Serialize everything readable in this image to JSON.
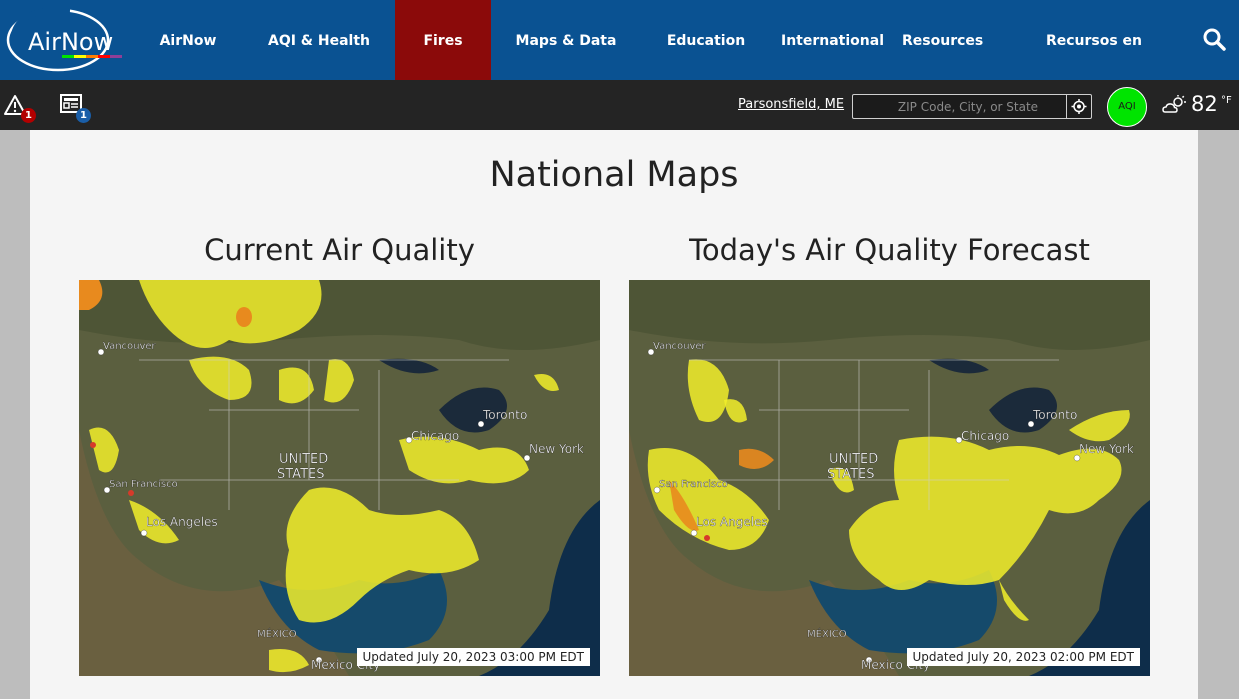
{
  "header": {
    "logo_text": "AirNow",
    "nav": [
      {
        "label": "AirNow"
      },
      {
        "label": "AQI & Health"
      },
      {
        "label": "Fires"
      },
      {
        "label": "Maps & Data"
      },
      {
        "label": "Education"
      },
      {
        "label": "International"
      },
      {
        "label": "Resources"
      },
      {
        "label": "Recursos en español"
      }
    ],
    "active": "Fires"
  },
  "subbar": {
    "alerts_count": "1",
    "news_count": "1",
    "location": "Parsonsfield, ME",
    "search_placeholder": "ZIP Code, City, or State",
    "aqi_label": "AQI",
    "aqi_color": "#00e400",
    "temperature": "82",
    "temp_unit": "°F"
  },
  "page": {
    "title": "National Maps"
  },
  "maps": [
    {
      "title": "Current Air Quality",
      "updated": "Updated July 20, 2023 03:00 PM EDT",
      "labels": [
        "Vancouver",
        "Toronto",
        "Chicago",
        "New York",
        "San Francisco",
        "Los Angeles",
        "UNITED",
        "STATES",
        "MÉXICO",
        "Mexico City"
      ]
    },
    {
      "title": "Today's Air Quality Forecast",
      "updated": "Updated July 20, 2023 02:00 PM EDT",
      "labels": [
        "Vancouver",
        "Toronto",
        "Chicago",
        "New York",
        "San Francisco",
        "Los Angeles",
        "UNITED",
        "STATES",
        "MÉXICO",
        "Mexico City"
      ]
    }
  ],
  "colors": {
    "nav_bg": "#0a5292",
    "nav_active": "#8b0a0a",
    "subbar_bg": "#242424",
    "aqi_moderate": "#ffff00",
    "aqi_usg": "#ff7e00",
    "aqi_unhealthy": "#ff0000"
  }
}
